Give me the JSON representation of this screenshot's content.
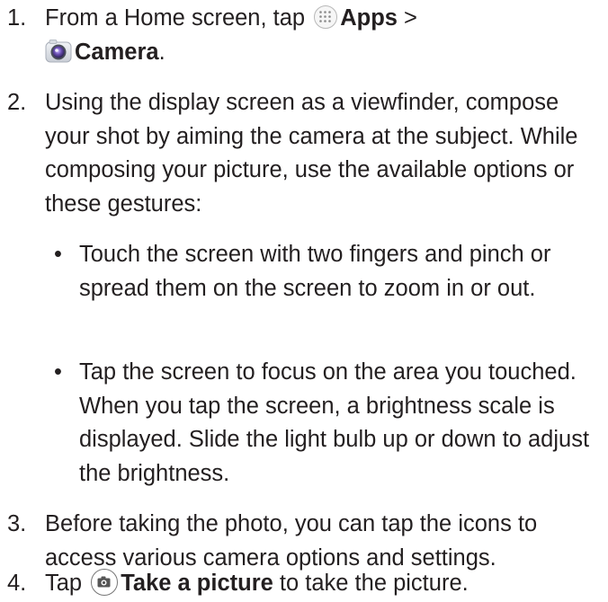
{
  "steps": [
    {
      "number": "1.",
      "parts": {
        "a": "From a Home screen, tap",
        "apps_label": "Apps",
        "sep": ">",
        "camera_label": "Camera",
        "period": "."
      }
    },
    {
      "number": "2.",
      "text": "Using the display screen as a viewfinder, compose your shot by aiming the camera at the subject. While composing your picture, use the available options or these gestures:",
      "bullets": [
        "Touch the screen with two fingers and pinch or spread them on the screen to zoom in or out.",
        "Tap the screen to focus on the area you touched. When you tap the screen, a brightness scale is displayed. Slide the light bulb up or down to adjust the brightness."
      ]
    },
    {
      "number": "3.",
      "text": "Before taking the photo, you can tap the icons to access various camera options and settings."
    },
    {
      "number": "4.",
      "parts": {
        "a": "Tap",
        "action_label": "Take a picture",
        "b": "to take the picture."
      }
    }
  ],
  "icons": {
    "apps": "apps-grid-icon",
    "camera_app": "camera-app-icon",
    "shutter": "camera-shutter-icon"
  },
  "colors": {
    "text": "#231f20",
    "camera_lens": "#6a4fb3"
  }
}
